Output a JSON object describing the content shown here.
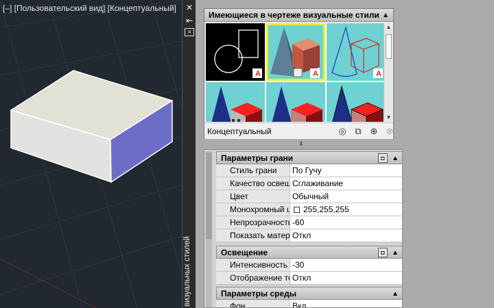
{
  "viewport": {
    "label": "[–] [Пользовательский вид] [Концептуальный]"
  },
  "palette": {
    "title": "визуальных стилей",
    "close_icon": "close-icon",
    "autohide_icon": "autohide-icon",
    "menu_icon": "properties-menu-icon"
  },
  "styles_panel": {
    "title": "Имеющиеся в чертеже визуальные стили",
    "current_style": "Концептуальный",
    "thumbnails": [
      {
        "name": "2D Wireframe",
        "bg": "#000000"
      },
      {
        "name": "Conceptual",
        "bg": "#6fd1d1",
        "selected": true
      },
      {
        "name": "Hidden",
        "bg": "#6fd1d1"
      },
      {
        "name": "Realistic",
        "bg": "#6fd1d1"
      },
      {
        "name": "Shaded",
        "bg": "#6fd1d1"
      },
      {
        "name": "Shaded with edges",
        "bg": "#6fd1d1"
      }
    ],
    "tools": [
      "create-style-icon",
      "apply-to-viewport-icon",
      "save-to-palette-icon",
      "delete-style-icon"
    ]
  },
  "properties": {
    "face": {
      "title": "Параметры грани",
      "rows": [
        {
          "key": "Стиль грани",
          "value": "По Гучу"
        },
        {
          "key": "Качество освеще...",
          "value": "Сглаживание"
        },
        {
          "key": "Цвет",
          "value": "Обычный"
        },
        {
          "key": "Монохромный ц...",
          "value": "255,255,255"
        },
        {
          "key": "Непрозрачность",
          "value": "-60"
        },
        {
          "key": "Показать матери...",
          "value": "Откл"
        }
      ]
    },
    "lighting": {
      "title": "Освещение",
      "rows": [
        {
          "key": "Интенсивность п...",
          "value": "-30"
        },
        {
          "key": "Отображение те...",
          "value": "Откл"
        }
      ]
    },
    "environment": {
      "title": "Параметры среды",
      "rows": [
        {
          "key": "Фон",
          "value": "Вкл"
        }
      ]
    }
  },
  "colors": {
    "viewport_bg": "#212830",
    "panel_bg": "#ababab",
    "selected_outline": "#e8f030",
    "thumb_bg": "#6fd1d1",
    "box_top": "#e1e1d6",
    "box_front": "#e2e2e0",
    "box_side": "#6d6dc8"
  }
}
